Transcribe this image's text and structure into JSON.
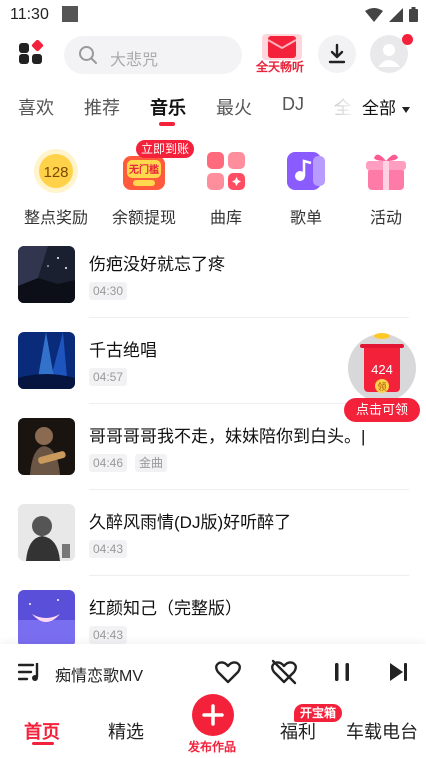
{
  "status_bar": {
    "time": "11:30"
  },
  "header": {
    "search_placeholder": "大悲咒",
    "promo_label": "全天畅听"
  },
  "tabs": [
    {
      "label": "喜欢"
    },
    {
      "label": "推荐"
    },
    {
      "label": "音乐"
    },
    {
      "label": "最火"
    },
    {
      "label": "DJ"
    },
    {
      "label": "全"
    }
  ],
  "tabs_all_label": "全部",
  "quick_actions": [
    {
      "label": "整点奖励",
      "icon": "coin-128-icon",
      "icon_text": "128"
    },
    {
      "label": "余额提现",
      "icon": "withdraw-icon",
      "icon_text": "无门槛",
      "badge": "立即到账"
    },
    {
      "label": "曲库",
      "icon": "library-grid-icon"
    },
    {
      "label": "歌单",
      "icon": "playlist-icon"
    },
    {
      "label": "活动",
      "icon": "gift-icon"
    }
  ],
  "songs": [
    {
      "title": "伤疤没好就忘了疼",
      "duration": "04:30",
      "tags": []
    },
    {
      "title": "千古绝唱",
      "duration": "04:57",
      "tags": []
    },
    {
      "title": "哥哥哥哥我不走，妹妹陪你到白头。|",
      "duration": "04:46",
      "tags": [
        "金曲"
      ]
    },
    {
      "title": "久醉风雨情(DJ版)好听醉了",
      "duration": "04:43",
      "tags": []
    },
    {
      "title": "红颜知己（完整版）",
      "duration": "04:43",
      "tags": []
    }
  ],
  "floating_redpack": {
    "amount": "424",
    "coin_label": "领",
    "button_label": "点击可领"
  },
  "mini_player": {
    "title": "痴情恋歌MV"
  },
  "bottom_nav": {
    "items": [
      {
        "label": "首页"
      },
      {
        "label": "精选"
      },
      {
        "label": "发布作品"
      },
      {
        "label": "福利",
        "badge": "开宝箱"
      },
      {
        "label": "车载电台"
      }
    ]
  },
  "colors": {
    "accent": "#f4213b"
  }
}
